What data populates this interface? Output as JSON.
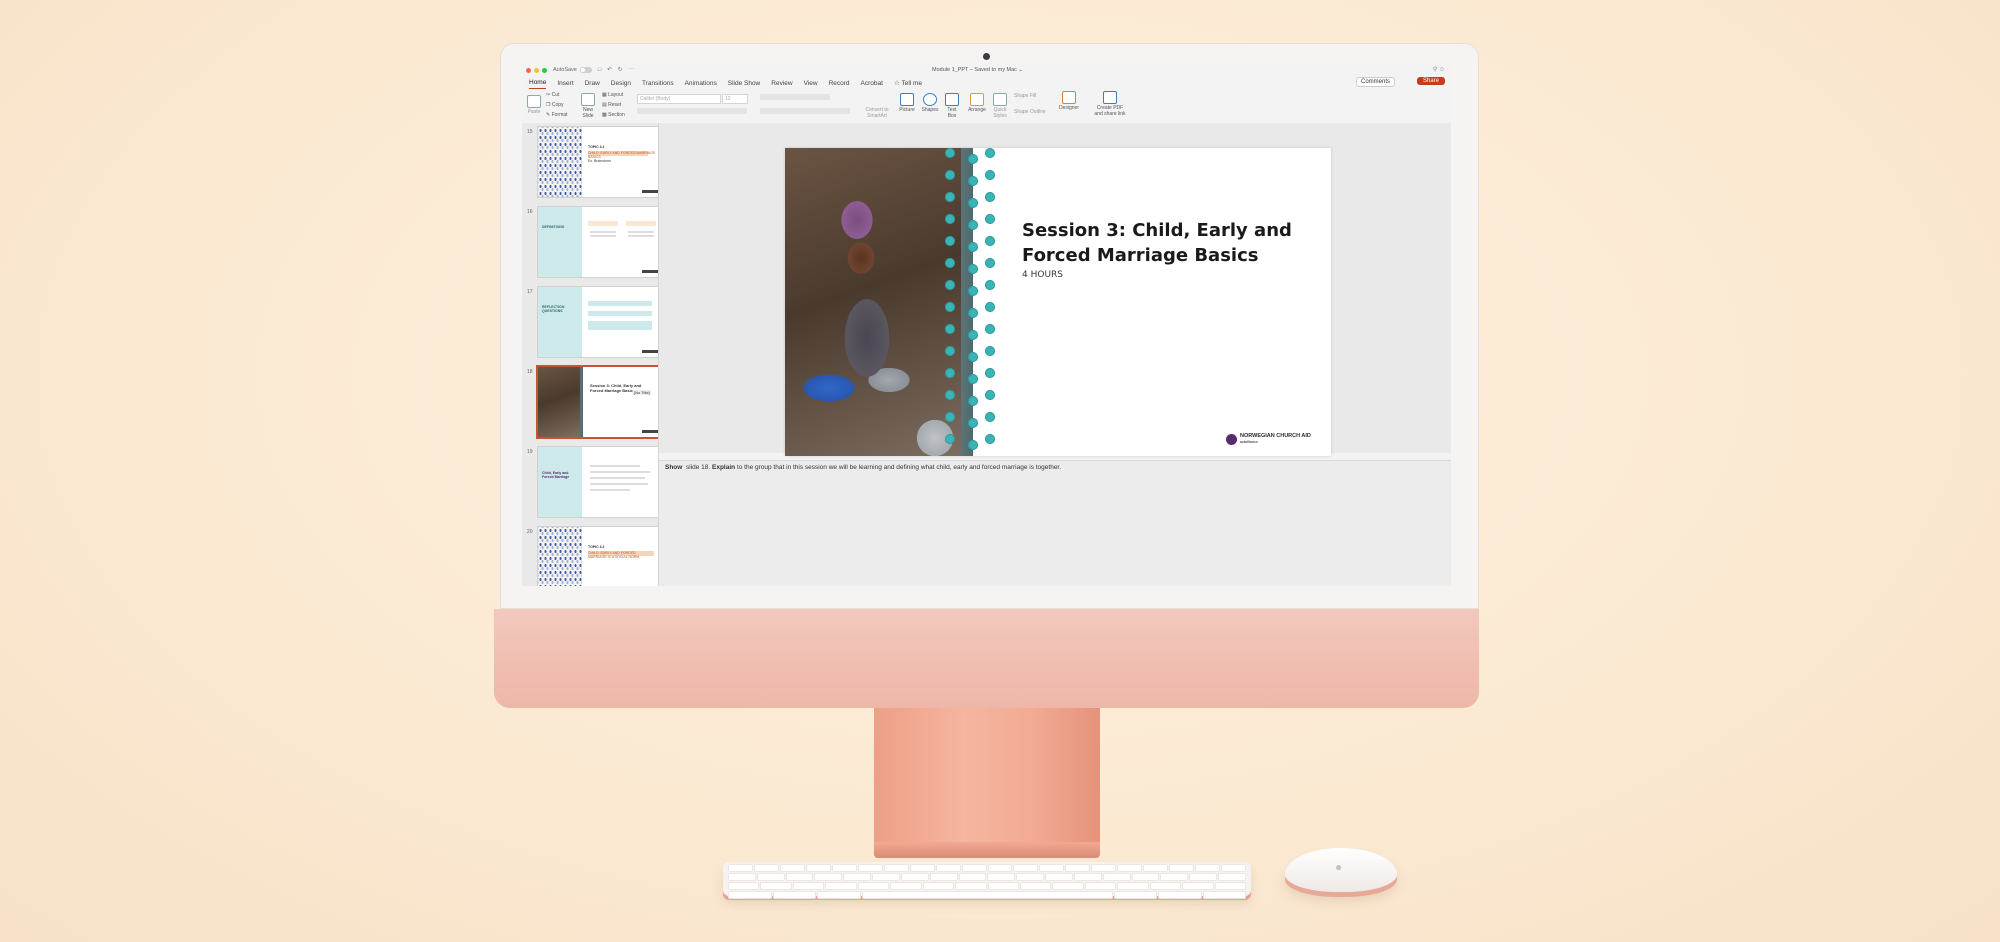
{
  "app": {
    "autosave_label": "AutoSave",
    "doc_title": "Module 1_PPT – Saved to my Mac ⌄"
  },
  "tabs": [
    {
      "label": "Home",
      "active": true
    },
    {
      "label": "Insert"
    },
    {
      "label": "Draw"
    },
    {
      "label": "Design"
    },
    {
      "label": "Transitions"
    },
    {
      "label": "Animations"
    },
    {
      "label": "Slide Show"
    },
    {
      "label": "Review"
    },
    {
      "label": "View"
    },
    {
      "label": "Record"
    },
    {
      "label": "Acrobat"
    },
    {
      "label": "☆ Tell me"
    }
  ],
  "header_buttons": {
    "comments": "Comments",
    "share": "Share"
  },
  "ribbon": {
    "paste": "Paste",
    "cut": "Cut",
    "copy": "Copy",
    "format": "Format",
    "new_slide": "New Slide",
    "layout": "Layout",
    "reset": "Reset",
    "section": "Section",
    "font_name": "Calibri (Body)",
    "font_size": "12",
    "convert_smartart": "Convert to SmartArt",
    "picture": "Picture",
    "shapes": "Shapes",
    "text_box": "Text Box",
    "arrange": "Arrange",
    "quick_styles": "Quick Styles",
    "shape_fill": "Shape Fill",
    "shape_outline": "Shape Outline",
    "designer": "Designer",
    "create_pdf": "Create PDF and share link"
  },
  "thumbnails": [
    {
      "number": "15",
      "title": "TOPIC 3.1",
      "subtitle": "CHILD, EARLY AND FORCED MARRIAGE BASICS",
      "note": "Ex. Brainstorm"
    },
    {
      "number": "16",
      "title": "DEFINITIONS"
    },
    {
      "number": "17",
      "title": "REFLECTION QUESTIONS"
    },
    {
      "number": "18",
      "title": "Session 3: Child, Early and Forced Marriage Basics",
      "placeholder": "[No Title]",
      "selected": true
    },
    {
      "number": "19",
      "title": "Child, Early and Forced Marriage"
    },
    {
      "number": "20",
      "title": "TOPIC 3.2",
      "subtitle": "CHILD, EARLY AND FORCED MARRIAGE IS A SOCIAL NORM"
    }
  ],
  "slide": {
    "title": "Session 3: Child, Early and Forced Marriage Basics",
    "subtitle": "4 HOURS",
    "logo_text": "NORWEGIAN CHURCH AID",
    "logo_small": "actalliance"
  },
  "notes": {
    "show": "Show",
    "slide_ref": "slide 18.",
    "explain": "Explain",
    "body": "to the group that in this session we will be learning and defining what child, early and forced marriage is together."
  },
  "colors": {
    "accent": "#c43e1c",
    "teal_bead": "#3ab4b7",
    "monitor_chin": "#f0bdb0",
    "background": "#fbe9d2"
  }
}
